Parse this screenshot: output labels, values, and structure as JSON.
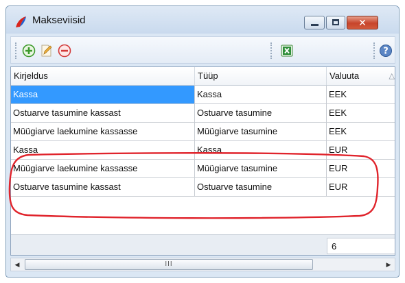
{
  "window": {
    "title": "Makseviisid",
    "close_glyph": "✕"
  },
  "toolbar": {
    "icons": [
      "add-icon",
      "edit-icon",
      "delete-icon",
      "excel-export-icon",
      "help-icon"
    ]
  },
  "grid": {
    "columns": [
      {
        "label": "Kirjeldus"
      },
      {
        "label": "Tüüp"
      },
      {
        "label": "Valuuta",
        "sort": "△"
      }
    ],
    "rows": [
      {
        "kirjeldus": "Kassa",
        "tyyp": "Kassa",
        "valuuta": "EEK"
      },
      {
        "kirjeldus": "Ostuarve tasumine kassast",
        "tyyp": "Ostuarve tasumine",
        "valuuta": "EEK"
      },
      {
        "kirjeldus": "Müügiarve laekumine kassasse",
        "tyyp": "Müügiarve tasumine",
        "valuuta": "EEK"
      },
      {
        "kirjeldus": "Kassa",
        "tyyp": "Kassa",
        "valuuta": "EUR"
      },
      {
        "kirjeldus": "Müügiarve laekumine kassasse",
        "tyyp": "Müügiarve tasumine",
        "valuuta": "EUR"
      },
      {
        "kirjeldus": "Ostuarve tasumine kassast",
        "tyyp": "Ostuarve tasumine",
        "valuuta": "EUR"
      }
    ],
    "footer_count": "6"
  },
  "scrollbar": {
    "left_arrow": "◀",
    "right_arrow": "▶",
    "grip": "III"
  },
  "colors": {
    "selection": "#3399ff",
    "annotation": "#e0242c"
  }
}
